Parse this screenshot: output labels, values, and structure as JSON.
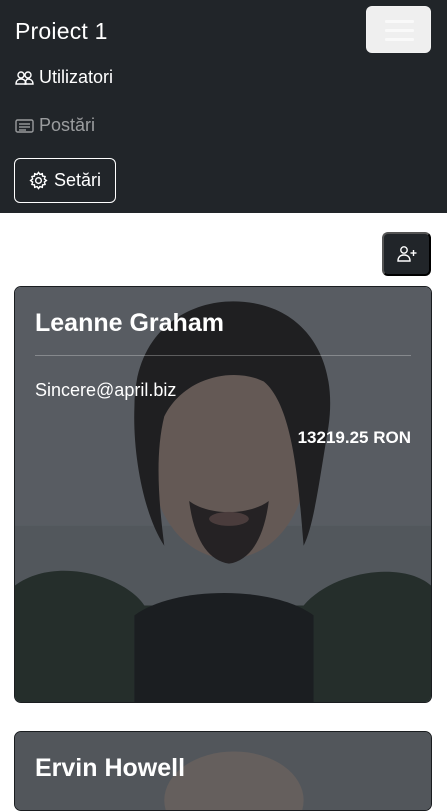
{
  "navbar": {
    "brand": "Proiect 1",
    "toggler_icon": "hamburger-icon",
    "items": [
      {
        "label": "Utilizatori",
        "icon": "people-icon",
        "active": true
      },
      {
        "label": "Postări",
        "icon": "card-text-icon",
        "active": false
      }
    ],
    "settings_button": {
      "label": "Setări",
      "icon": "gear-icon"
    }
  },
  "toolbar": {
    "add_user_icon": "person-plus-icon"
  },
  "users": [
    {
      "name": "Leanne Graham",
      "email": "Sincere@april.biz",
      "balance": "13219.25 RON"
    },
    {
      "name": "Ervin Howell"
    }
  ],
  "colors": {
    "navbar_bg": "#212529",
    "page_bg": "#ffffff",
    "muted_link": "rgba(255,255,255,0.55)"
  }
}
